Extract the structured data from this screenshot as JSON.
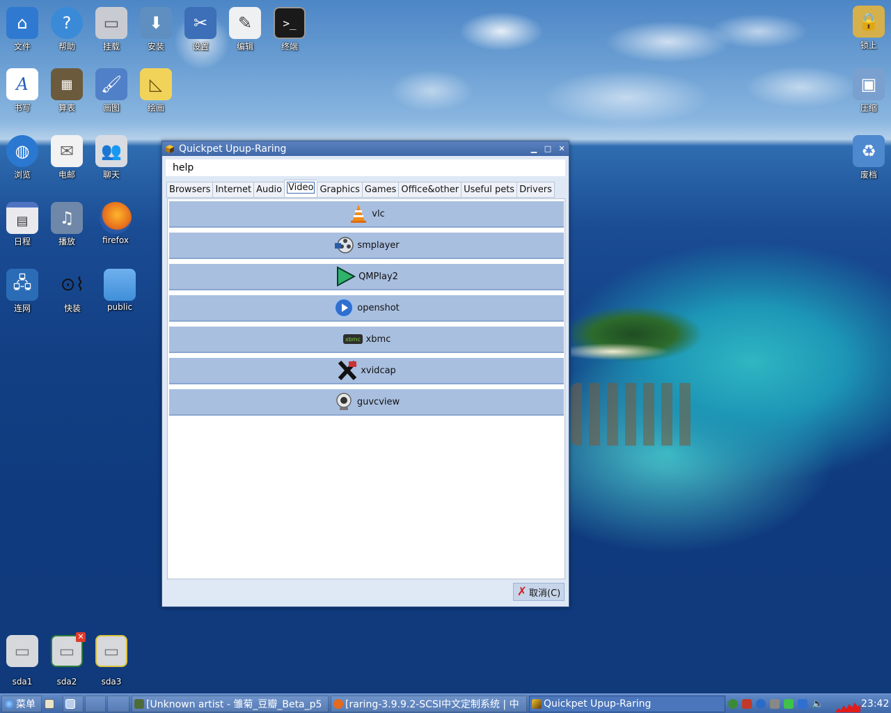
{
  "desktop": {
    "left_icons": [
      {
        "label": "文件",
        "icon": "home-folder-icon",
        "color": "#2f7ad0"
      },
      {
        "label": "帮助",
        "icon": "help-icon",
        "color": "#3a8ad8"
      },
      {
        "label": "挂载",
        "icon": "drive-icon",
        "color": "#c8ccd2"
      },
      {
        "label": "安装",
        "icon": "install-icon",
        "color": "#5e8fc0"
      },
      {
        "label": "设置",
        "icon": "settings-tools-icon",
        "color": "#3c6fb8"
      },
      {
        "label": "编辑",
        "icon": "text-editor-icon",
        "color": "#eef0f2"
      },
      {
        "label": "终端",
        "icon": "terminal-icon",
        "color": "#1a1a1a"
      },
      {
        "label": "书写",
        "icon": "writer-icon",
        "color": "#ffffff"
      },
      {
        "label": "算表",
        "icon": "spreadsheet-icon",
        "color": "#6b5b3c"
      },
      {
        "label": "画图",
        "icon": "paint-icon",
        "color": "#5080c8"
      },
      {
        "label": "绘画",
        "icon": "draw-icon",
        "color": "#f2d35a"
      },
      {
        "label": "浏览",
        "icon": "browser-icon",
        "color": "#2b78d0"
      },
      {
        "label": "电邮",
        "icon": "email-icon",
        "color": "#f2f2f2"
      },
      {
        "label": "聊天",
        "icon": "chat-icon",
        "color": "#d8dce2"
      },
      {
        "label": "日程",
        "icon": "calendar-icon",
        "color": "#e9e9ee"
      },
      {
        "label": "播放",
        "icon": "media-player-icon",
        "color": "#6f87a8"
      },
      {
        "label": "firefox",
        "icon": "firefox-icon",
        "color": "#e46a1c"
      },
      {
        "label": "连网",
        "icon": "network-icon",
        "color": "#2b6cb6"
      },
      {
        "label": "快装",
        "icon": "quickpet-icon",
        "color": "#111111"
      },
      {
        "label": "public",
        "icon": "folder-icon",
        "color": "#3f8fd8"
      }
    ],
    "right_icons": [
      {
        "label": "锁上",
        "icon": "lock-icon",
        "color": "#d6b04b"
      },
      {
        "label": "压缩",
        "icon": "archive-icon",
        "color": "#7aa0cf"
      },
      {
        "label": "废档",
        "icon": "trash-icon",
        "color": "#4e88cf"
      }
    ],
    "drives": [
      {
        "label": "sda1",
        "icon": "drive-icon"
      },
      {
        "label": "sda2",
        "icon": "drive-icon"
      },
      {
        "label": "sda3",
        "icon": "drive-icon"
      }
    ]
  },
  "window": {
    "title": "Quickpet Upup-Raring",
    "minimize": "▁",
    "maximize": "□",
    "close": "✕",
    "help_text": "help",
    "tabs": [
      "Browsers",
      "Internet",
      "Audio",
      "Video",
      "Graphics",
      "Games",
      "Office&other",
      "Useful pets",
      "Drivers"
    ],
    "active_tab": "Video",
    "items": [
      {
        "label": "vlc",
        "icon": "vlc-icon"
      },
      {
        "label": "smplayer",
        "icon": "smplayer-icon"
      },
      {
        "label": "QMPlay2",
        "icon": "qmplay2-icon"
      },
      {
        "label": "openshot",
        "icon": "openshot-icon"
      },
      {
        "label": "xbmc",
        "icon": "xbmc-icon"
      },
      {
        "label": "xvidcap",
        "icon": "xvidcap-icon"
      },
      {
        "label": "guvcview",
        "icon": "guvcview-icon"
      }
    ],
    "cancel_label": "取消(C)"
  },
  "taskbar": {
    "menu_label": "菜单",
    "tasks": [
      "[Unknown artist - 雏菊_豆瓣_Beta_p5",
      "[raring-3.9.9.2-SCSI中文定制系统 | 中",
      "Quickpet Upup-Raring"
    ],
    "clock": "23:42"
  }
}
